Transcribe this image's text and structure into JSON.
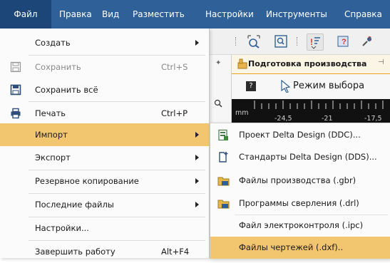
{
  "menubar": {
    "items": [
      "Файл",
      "Правка",
      "Вид",
      "Разместить",
      "Настройки",
      "Инструменты",
      "Справка"
    ]
  },
  "file_menu": {
    "items": [
      {
        "label": "Создать",
        "shortcut": "",
        "submenu": true,
        "enabled": true
      },
      {
        "label": "Сохранить",
        "shortcut": "Ctrl+S",
        "submenu": false,
        "enabled": false,
        "icon": "save-icon"
      },
      {
        "label": "Сохранить всё",
        "shortcut": "",
        "submenu": false,
        "enabled": true,
        "icon": "save-all-icon"
      },
      {
        "label": "Печать",
        "shortcut": "Ctrl+P",
        "submenu": false,
        "enabled": true,
        "icon": "printer-icon"
      },
      {
        "label": "Импорт",
        "shortcut": "",
        "submenu": true,
        "enabled": true
      },
      {
        "label": "Экспорт",
        "shortcut": "",
        "submenu": true,
        "enabled": true
      },
      {
        "label": "Резервное копирование",
        "shortcut": "",
        "submenu": true,
        "enabled": true
      },
      {
        "label": "Последние файлы",
        "shortcut": "",
        "submenu": true,
        "enabled": true
      },
      {
        "label": "Настройки...",
        "shortcut": "",
        "submenu": false,
        "enabled": true
      },
      {
        "label": "Завершить работу",
        "shortcut": "Alt+F4",
        "submenu": false,
        "enabled": true
      }
    ]
  },
  "import_submenu": {
    "items": [
      {
        "label": "Проект Delta Design (DDC)...",
        "icon": "project-icon"
      },
      {
        "label": "Стандарты Delta Design (DDS)...",
        "icon": "standards-icon"
      },
      {
        "label": "Файлы производства (.gbr)",
        "icon": "gerber-icon"
      },
      {
        "label": "Программы сверления (.drl)",
        "icon": "drill-icon"
      },
      {
        "label": "Файл электроконтроля (.ipc)",
        "icon": ""
      },
      {
        "label": "Файлы чертежей (.dxf)..",
        "icon": ""
      }
    ]
  },
  "panel": {
    "title": "Подготовка производства",
    "mode": "Режим выбора"
  },
  "ruler": {
    "unit": "mm",
    "ticks": [
      "-24,5",
      "-21",
      "-17,5"
    ]
  },
  "colors": {
    "menubar": "#2f6198",
    "highlight": "#f2c56f",
    "accent": "#e9a320"
  }
}
